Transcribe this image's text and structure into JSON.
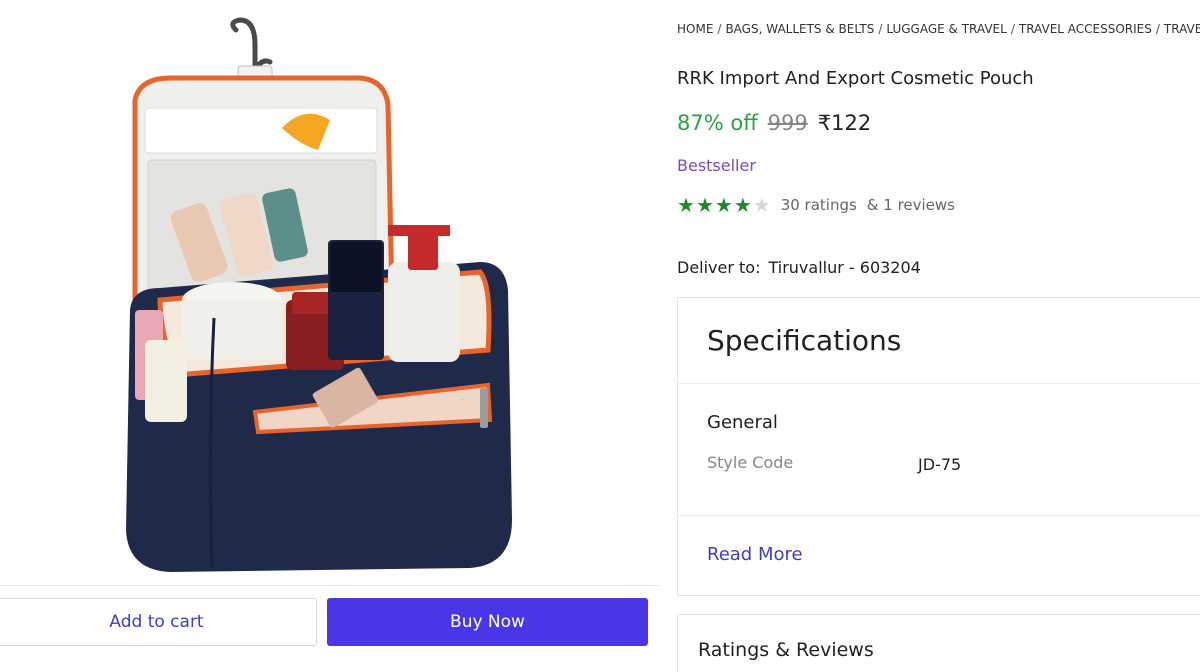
{
  "product_image": {
    "alt": "Navy cosmetic pouch with orange zippers and toiletries"
  },
  "actions": {
    "add_to_cart": "Add to cart",
    "buy_now": "Buy Now"
  },
  "breadcrumb": [
    "HOME",
    "BAGS, WALLETS & BELTS",
    "LUGGAGE & TRAVEL",
    "TRAVEL ACCESSORIES",
    "TRAVEL PO"
  ],
  "product": {
    "title": "RRK Import And Export Cosmetic Pouch",
    "discount": "87% off",
    "mrp": "999",
    "price": "₹122",
    "badge": "Bestseller",
    "rating_stars": 4,
    "rating_max": 5,
    "ratings_text": "30 ratings",
    "reviews_text": "& 1 reviews"
  },
  "delivery": {
    "label": "Deliver to:",
    "location": "Tiruvallur - 603204"
  },
  "specifications": {
    "title": "Specifications",
    "group": "General",
    "rows": [
      {
        "key": "Style Code",
        "value": "JD-75"
      }
    ],
    "read_more": "Read More"
  },
  "reviews_section": {
    "title": "Ratings & Reviews"
  },
  "colors": {
    "discount": "#26a541",
    "accent": "#4a35e8",
    "link": "#3d3dc9",
    "bestseller": "#7a4bc9",
    "star": "#1a8a2b"
  }
}
